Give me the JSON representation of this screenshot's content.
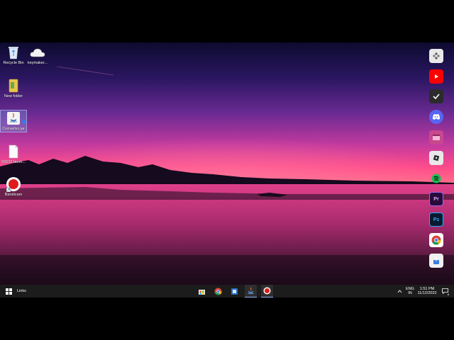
{
  "desktop": {
    "icons": [
      {
        "label": "Recycle Bin",
        "icon": "recycle-bin-icon"
      },
      {
        "label": "keymaker...",
        "icon": "cloud-icon"
      },
      {
        "label": "New folder",
        "icon": "folder-icon"
      },
      {
        "label": "Converter.jar",
        "icon": "java-icon"
      },
      {
        "label": "56532.btem...",
        "icon": "file-icon"
      },
      {
        "label": "Bandicam",
        "icon": "bandicam-icon"
      }
    ]
  },
  "dock": {
    "items": [
      "settings-icon",
      "youtube-icon",
      "todo-icon",
      "discord-icon",
      "window-app-icon",
      "roblox-icon",
      "spotify-icon",
      "premiere-pro-icon",
      "photoshop-icon",
      "chrome-icon",
      "share-icon"
    ]
  },
  "taskbar": {
    "links_label": "Links",
    "apps": [
      "microsoft-store-icon",
      "chrome-icon",
      "explorer-icon",
      "java-app-icon",
      "bandicam-icon"
    ],
    "language_top": "ENG",
    "language_bottom": "IN",
    "time": "1:51 PM",
    "date": "11/12/2022",
    "notification_count": "6"
  },
  "colors": {
    "sky_top": "#1e1250",
    "sky_mid": "#7a2b8f",
    "sky_glow": "#ff3f8e",
    "water": "#c02a6a",
    "taskbar": "#1c1c1c"
  }
}
